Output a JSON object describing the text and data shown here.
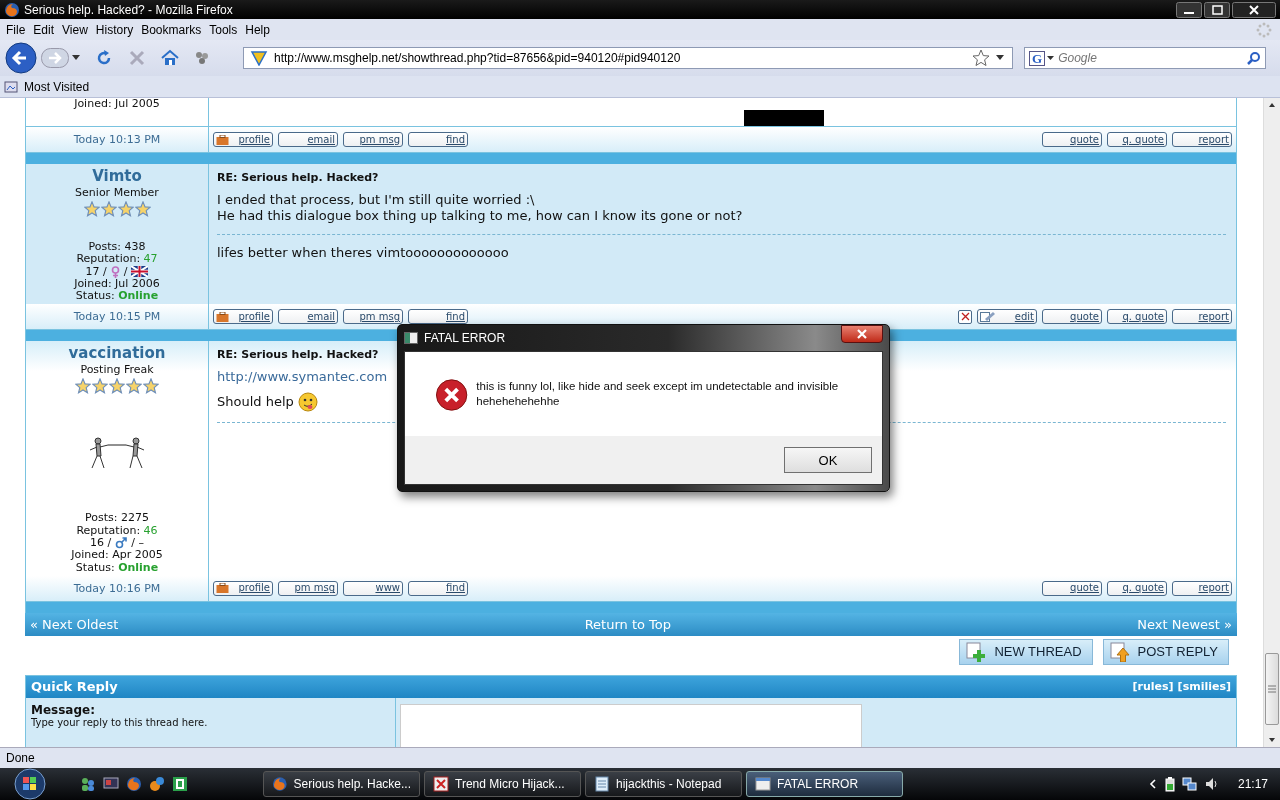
{
  "window": {
    "title": "Serious help. Hacked? - Mozilla Firefox"
  },
  "menu": [
    "File",
    "Edit",
    "View",
    "History",
    "Bookmarks",
    "Tools",
    "Help"
  ],
  "address": {
    "value": "http://www.msghelp.net/showthread.php?tid=87656&pid=940120#pid940120"
  },
  "search": {
    "engine": "G",
    "placeholder": "Google"
  },
  "bookmarks": [
    "Most Visited"
  ],
  "top_post": {
    "joined": "Joined: Jul 2005",
    "time": "Today 10:13 PM",
    "left_buttons": [
      {
        "label": "profile",
        "kind": "profile"
      },
      {
        "label": "email",
        "kind": "plain"
      },
      {
        "label": "pm msg",
        "kind": "plain"
      },
      {
        "label": "find",
        "kind": "plain"
      }
    ],
    "right_buttons": [
      {
        "label": "quote",
        "kind": "plain"
      },
      {
        "label": "q. quote",
        "kind": "plain"
      },
      {
        "label": "report",
        "kind": "plain"
      }
    ]
  },
  "posts": [
    {
      "user": "Vimto",
      "rank": "Senior Member",
      "stars": 4,
      "has_avatar": false,
      "highlighted": true,
      "posts": "Posts: 438",
      "rep_label": "Reputation:",
      "rep": "47",
      "details": [
        {
          "kind": "text",
          "text": "17 /"
        },
        {
          "kind": "female"
        },
        {
          "kind": "text",
          "text": "/"
        },
        {
          "kind": "flag"
        }
      ],
      "joined": "Joined: Jul 2006",
      "status_label": "Status:",
      "status": "Online",
      "subject": "RE: Serious help. Hacked?",
      "body": [
        {
          "kind": "text",
          "text": "I ended that process, but I'm still quite worried :\\"
        },
        {
          "kind": "text",
          "text": "He had this dialogue box thing up talking to me, how can I know its gone or not?"
        }
      ],
      "signature": "lifes better when theres vimtooooooooooooo",
      "time": "Today 10:15 PM",
      "left_buttons": [
        {
          "label": "profile",
          "kind": "profile"
        },
        {
          "label": "email",
          "kind": "plain"
        },
        {
          "label": "pm msg",
          "kind": "plain"
        },
        {
          "label": "find",
          "kind": "plain"
        }
      ],
      "right_buttons": [
        {
          "kind": "delete"
        },
        {
          "label": "edit",
          "kind": "edit"
        },
        {
          "label": "quote",
          "kind": "plain"
        },
        {
          "label": "q. quote",
          "kind": "plain"
        },
        {
          "label": "report",
          "kind": "plain"
        }
      ]
    },
    {
      "user": "vaccination",
      "rank": "Posting Freak",
      "stars": 5,
      "has_avatar": true,
      "highlighted": false,
      "posts": "Posts: 2275",
      "rep_label": "Reputation:",
      "rep": "46",
      "details": [
        {
          "kind": "text",
          "text": "16 /"
        },
        {
          "kind": "male"
        },
        {
          "kind": "text",
          "text": "/ –"
        }
      ],
      "joined": "Joined: Apr 2005",
      "status_label": "Status:",
      "status": "Online",
      "subject": "RE: Serious help. Hacked?",
      "body": [
        {
          "kind": "link",
          "text": "http://www.symantec.com"
        },
        {
          "kind": "smiley",
          "text": "Should help"
        }
      ],
      "time": "Today 10:16 PM",
      "left_buttons": [
        {
          "label": "profile",
          "kind": "profile"
        },
        {
          "label": "pm msg",
          "kind": "plain"
        },
        {
          "label": "www",
          "kind": "plain"
        },
        {
          "label": "find",
          "kind": "plain"
        }
      ],
      "right_buttons": [
        {
          "label": "quote",
          "kind": "plain"
        },
        {
          "label": "q. quote",
          "kind": "plain"
        },
        {
          "label": "report",
          "kind": "plain"
        }
      ]
    }
  ],
  "nav": {
    "prev": "« Next Oldest",
    "top": "Return to Top",
    "next": "Next Newest »"
  },
  "actions": [
    {
      "label": "NEW THREAD",
      "kind": "new"
    },
    {
      "label": "POST REPLY",
      "kind": "reply"
    }
  ],
  "quick_reply": {
    "title": "Quick Reply",
    "links": [
      "[rules]",
      "[smilies]"
    ],
    "label": "Message:",
    "hint": "Type your reply to this thread here."
  },
  "dialog": {
    "title": "FATAL ERROR",
    "message": "this is funny lol, like hide and seek except im undetectable and invisible hehehehehehhe",
    "button": "OK"
  },
  "status_bar": "Done",
  "taskbar": {
    "tasks": [
      {
        "label": "Serious help. Hacke...",
        "kind": "firefox",
        "selected": false
      },
      {
        "label": "Trend Micro Hijack...",
        "kind": "tool",
        "selected": false
      },
      {
        "label": "hijackthis - Notepad",
        "kind": "notepad",
        "selected": false
      },
      {
        "label": "FATAL ERROR",
        "kind": "window",
        "selected": true
      }
    ],
    "clock": "21:17"
  }
}
